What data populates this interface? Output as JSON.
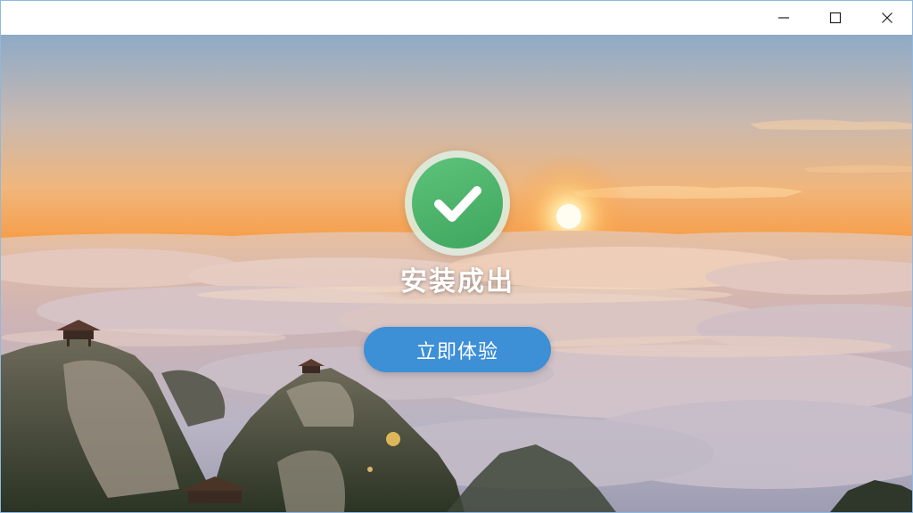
{
  "window": {
    "controls": {
      "minimize_icon": "minimize-icon",
      "maximize_icon": "maximize-icon",
      "close_icon": "close-icon"
    }
  },
  "main": {
    "status_icon": "checkmark-icon",
    "status_text": "安装成出",
    "start_button_label": "立即体验"
  },
  "colors": {
    "accent": "#3d8fd6",
    "success": "#4cb86c"
  }
}
